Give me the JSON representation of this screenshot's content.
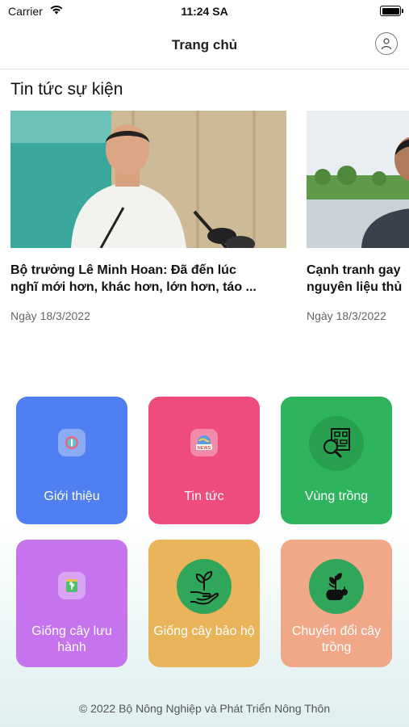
{
  "status_bar": {
    "carrier": "Carrier",
    "time": "11:24 SA"
  },
  "navbar": {
    "title": "Trang chủ"
  },
  "news": {
    "section_title": "Tin tức sự kiện",
    "items": [
      {
        "title": "Bộ trưởng Lê Minh Hoan: Đã đến lúc\nnghĩ mới hơn, khác hơn, lớn hơn, táo ...",
        "date": "Ngày 18/3/2022"
      },
      {
        "title": "Cạnh tranh gay\nnguyên liệu thủ",
        "date": "Ngày 18/3/2022"
      }
    ]
  },
  "tiles": [
    {
      "label": "Giới thiệu",
      "color": "#4f7ff0",
      "icon": "info-icon"
    },
    {
      "label": "Tin tức",
      "color": "#ee4c7c",
      "icon": "news-icon"
    },
    {
      "label": "Vùng trồng",
      "color": "#2fb45e",
      "icon": "map-search-icon"
    },
    {
      "label": "Giống cây lưu hành",
      "color": "#c674ee",
      "icon": "seed-bag-icon"
    },
    {
      "label": "Giống cây bảo hộ",
      "color": "#eab45a",
      "icon": "plant-hand-icon"
    },
    {
      "label": "Chuyển đổi cây trồng",
      "color": "#f0a888",
      "icon": "plant-convert-icon"
    }
  ],
  "footer": {
    "text": "© 2022 Bộ Nông Nghiệp và Phát Triển Nông Thôn"
  }
}
